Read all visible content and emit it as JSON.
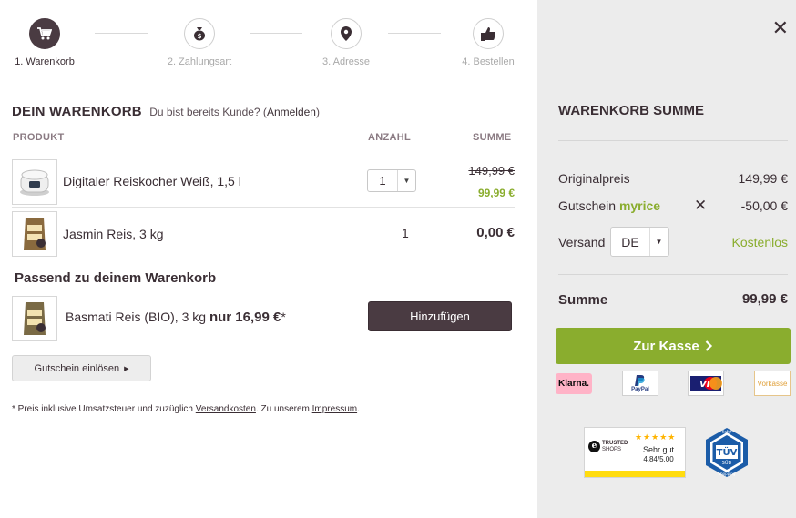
{
  "steps": [
    {
      "label": "1. Warenkorb"
    },
    {
      "label": "2. Zahlungsart"
    },
    {
      "label": "3. Adresse"
    },
    {
      "label": "4. Bestellen"
    }
  ],
  "cart": {
    "title": "DEIN WARENKORB",
    "customer_prompt": "Du bist bereits Kunde? (",
    "login_link": "Anmelden",
    "prompt_end": ")",
    "headers": {
      "product": "PRODUKT",
      "quantity": "ANZAHL",
      "sum": "SUMME"
    },
    "items": [
      {
        "name": "Digitaler Reiskocher Weiß, 1,5 l",
        "quantity": "1",
        "price_old": "149,99 €",
        "price_new": "99,99 €"
      },
      {
        "name": "Jasmin Reis, 3 kg",
        "quantity": "1",
        "price": "0,00 €"
      }
    ],
    "suggestion_title": "Passend zu deinem Warenkorb",
    "suggestion": {
      "name": "Basmati Reis (BIO), 3 kg",
      "price_prefix": "nur",
      "price": "16,99 €",
      "asterisk": "*",
      "button": "Hinzufügen"
    },
    "voucher_button": "Gutschein einlösen",
    "footnote": {
      "part1": "* Preis inklusive Umsatzsteuer und zuzüglich ",
      "link1": "Versandkosten",
      "part2": ". Zu unserem ",
      "link2": "Impressum",
      "part3": "."
    }
  },
  "summary": {
    "title": "WARENKORB SUMME",
    "original_label": "Originalpreis",
    "original_value": "149,99 €",
    "coupon_label": "Gutschein",
    "coupon_code": "myrice",
    "coupon_value": "-50,00 €",
    "shipping_label": "Versand",
    "country": "DE",
    "shipping_value": "Kostenlos",
    "total_label": "Summe",
    "total_value": "99,99 €",
    "checkout_button": "Zur Kasse",
    "payments": {
      "klarna": "Klarna.",
      "paypal": "PayPal",
      "vorkasse": "Vorkasse"
    },
    "trusted": {
      "brand_line1": "TRUSTED",
      "brand_line2": "SHOPS",
      "rating_text": "Sehr gut",
      "score": "4.84/5.00"
    },
    "tuv": {
      "top": "Safer",
      "mark": "TÜV",
      "sub": "SÜD",
      "bottom": "Shopping"
    }
  },
  "colors": {
    "accent_green": "#8aad2e",
    "dark": "#4a3b42",
    "sidebar_bg": "#ececec"
  }
}
